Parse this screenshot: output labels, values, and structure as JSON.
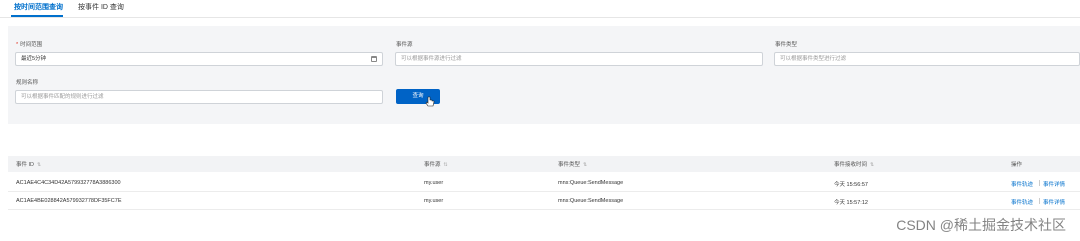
{
  "tabs": [
    {
      "label": "按时间范围查询"
    },
    {
      "label": "按事件 ID 查询"
    }
  ],
  "form": {
    "time_range": {
      "label": "时间范围",
      "required_mark": "*",
      "value": "最近5分钟"
    },
    "event_source": {
      "label": "事件源",
      "placeholder": "可以根据事件源进行过滤"
    },
    "event_type": {
      "label": "事件类型",
      "placeholder": "可以根据事件类型进行过滤"
    },
    "rule_name": {
      "label": "规则名称",
      "placeholder": "可以根据事件匹配的规则进行过滤"
    },
    "search_label": "查询"
  },
  "table": {
    "columns": [
      "事件 ID",
      "事件源",
      "事件类型",
      "事件接收时间",
      "操作"
    ],
    "sort_glyph": "⇅",
    "rows": [
      {
        "id": "AC1AE4C4C34D42A579932778A3886300",
        "source": "my.user",
        "type": "mns:Queue:SendMessage",
        "time": "今天 15:56:57",
        "action_trace": "事件轨迹",
        "action_detail": "事件详情"
      },
      {
        "id": "AC1AE4BE028842A579932778DF35FC7E",
        "source": "my.user",
        "type": "mns:Queue:SendMessage",
        "time": "今天 15:57:12",
        "action_trace": "事件轨迹",
        "action_detail": "事件详情"
      }
    ]
  },
  "watermark": "CSDN @稀土掘金技术社区"
}
